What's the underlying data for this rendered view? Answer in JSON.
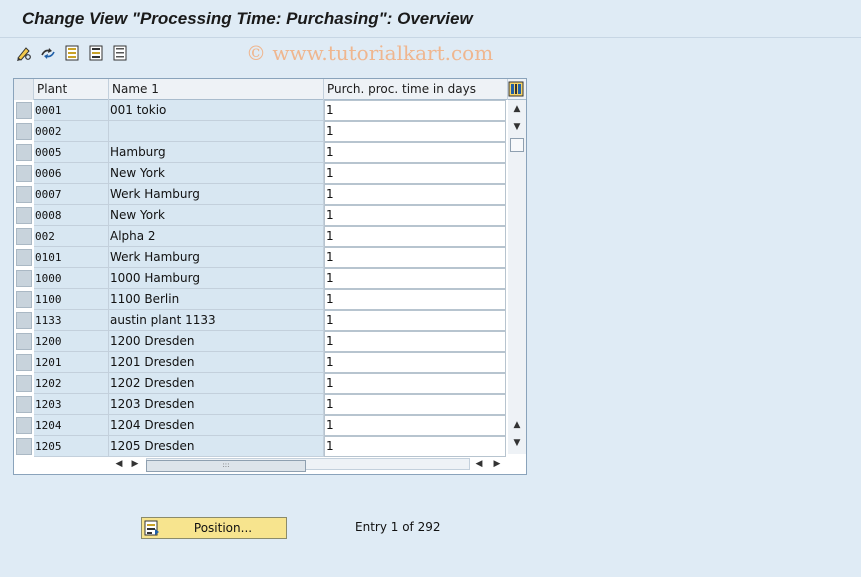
{
  "title": "Change View \"Processing Time: Purchasing\": Overview",
  "watermark": "© www.tutorialkart.com",
  "toolbar": {
    "buttons": [
      {
        "icon": "pencil-glasses-icon"
      },
      {
        "icon": "swap-icon"
      },
      {
        "icon": "select-all-icon"
      },
      {
        "icon": "select-block-icon"
      },
      {
        "icon": "deselect-all-icon"
      }
    ]
  },
  "table": {
    "columns": [
      "Plant",
      "Name 1",
      "Purch. proc. time in days"
    ],
    "rows": [
      {
        "plant": "0001",
        "name": "001 tokio",
        "time": "1"
      },
      {
        "plant": "0002",
        "name": "",
        "time": "1"
      },
      {
        "plant": "0005",
        "name": "Hamburg",
        "time": "1"
      },
      {
        "plant": "0006",
        "name": "New York",
        "time": "1"
      },
      {
        "plant": "0007",
        "name": "Werk Hamburg",
        "time": "1"
      },
      {
        "plant": "0008",
        "name": "New York",
        "time": "1"
      },
      {
        "plant": "002",
        "name": "Alpha 2",
        "time": "1"
      },
      {
        "plant": "0101",
        "name": "Werk Hamburg",
        "time": "1"
      },
      {
        "plant": "1000",
        "name": "1000 Hamburg",
        "time": "1"
      },
      {
        "plant": "1100",
        "name": "1100 Berlin",
        "time": "1"
      },
      {
        "plant": "1133",
        "name": "austin plant 1133",
        "time": "1"
      },
      {
        "plant": "1200",
        "name": "1200 Dresden",
        "time": "1"
      },
      {
        "plant": "1201",
        "name": "1201 Dresden",
        "time": "1"
      },
      {
        "plant": "1202",
        "name": "1202 Dresden",
        "time": "1"
      },
      {
        "plant": "1203",
        "name": "1203 Dresden",
        "time": "1"
      },
      {
        "plant": "1204",
        "name": "1204 Dresden",
        "time": "1"
      },
      {
        "plant": "1205",
        "name": "1205 Dresden",
        "time": "1"
      }
    ]
  },
  "position_button": {
    "label": "Position...",
    "icon": "position-icon"
  },
  "entry_info": "Entry 1 of 292",
  "colors": {
    "background": "#dfebf5",
    "key_cell": "#d8e7f2",
    "button": "#f7e48e",
    "watermark": "#f0b48a"
  }
}
